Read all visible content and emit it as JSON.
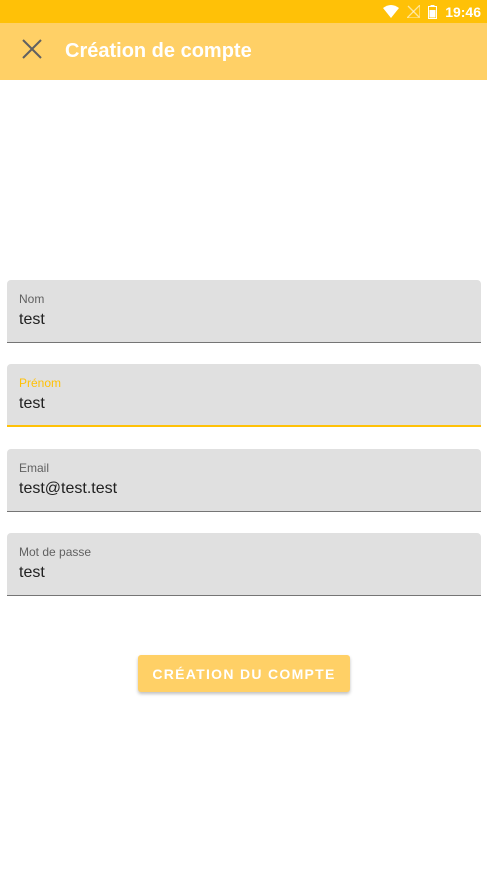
{
  "status_bar": {
    "time": "19:46",
    "icons": [
      "wifi-icon",
      "no-signal-icon",
      "battery-icon"
    ]
  },
  "app_bar": {
    "title": "Création de compte",
    "close_icon": "close-icon"
  },
  "form": {
    "fields": [
      {
        "label": "Nom",
        "value": "test"
      },
      {
        "label": "Prénom",
        "value": "test"
      },
      {
        "label": "Email",
        "value": "test@test.test"
      },
      {
        "label": "Mot de passe",
        "value": "test"
      }
    ]
  },
  "submit": {
    "label": "CRÉATION DU COMPTE"
  },
  "colors": {
    "status_bar": "#ffc107",
    "app_bar": "#ffd066",
    "accent": "#ffc107",
    "field_bg": "#e0e0e0"
  }
}
